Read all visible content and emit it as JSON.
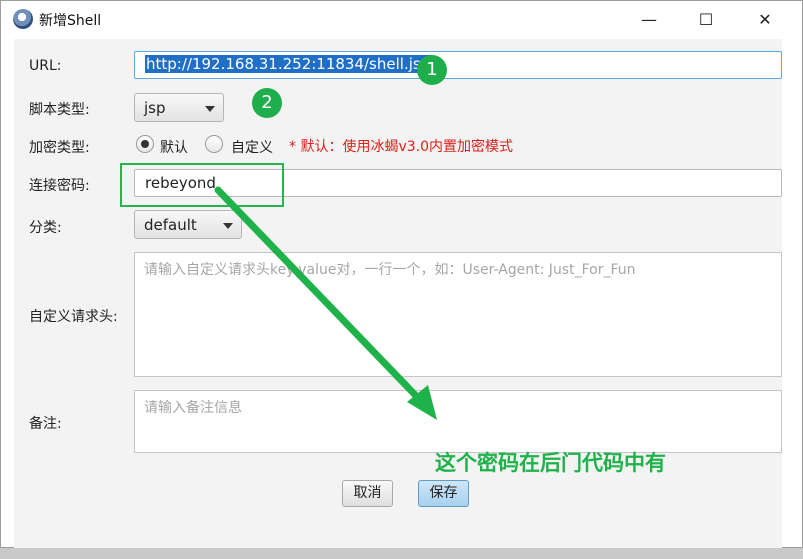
{
  "window": {
    "title": "新增Shell",
    "buttons": {
      "minimize": "—",
      "maximize": "☐",
      "close": "✕"
    }
  },
  "form": {
    "url": {
      "label": "URL:",
      "value": "http://192.168.31.252:11834/shell.jsp"
    },
    "script_type": {
      "label": "脚本类型:",
      "selected": "jsp"
    },
    "encrypt_type": {
      "label": "加密类型:",
      "options": [
        "默认",
        "自定义"
      ],
      "selected": "默认",
      "hint": "* 默认：使用冰蝎v3.0内置加密模式"
    },
    "password": {
      "label": "连接密码:",
      "value": "rebeyond"
    },
    "category": {
      "label": "分类:",
      "selected": "default"
    },
    "headers": {
      "label": "自定义请求头:",
      "placeholder": "请输入自定义请求头key:value对，一行一个，如：User-Agent: Just_For_Fun"
    },
    "note": {
      "label": "备注:",
      "placeholder": "请输入备注信息"
    }
  },
  "actions": {
    "cancel": "取消",
    "save": "保存"
  },
  "annotations": {
    "badge1": "1",
    "badge2": "2",
    "note_text": "这个密码在后门代码中有",
    "color": "#20b24a"
  }
}
